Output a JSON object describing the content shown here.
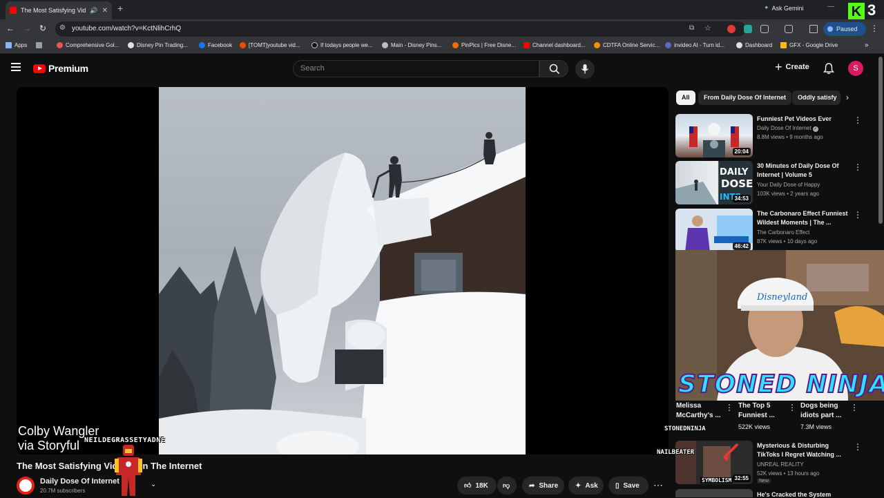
{
  "browser": {
    "tab_title": "The Most Satisfying Videos",
    "ask_gemini": "Ask Gemini",
    "url": "youtube.com/watch?v=KctNlihCrhQ",
    "paused_label": "Paused",
    "bookmarks": [
      "Apps",
      "Comprehensive Gol...",
      "Disney Pin Trading...",
      "Facebook",
      "[TOMT]youtube vid...",
      "If todays people we...",
      "Main - Disney Pins...",
      "PinPics | Free Disne...",
      "Channel dashboard...",
      "CDTFA Online Servic...",
      "invideo AI - Turn id...",
      "Dashboard",
      "GFX - Google Drive"
    ]
  },
  "overlay_badge": {
    "letter": "K",
    "number": "3"
  },
  "masthead": {
    "logo_text": "Premium",
    "search_placeholder": "Search",
    "create_label": "Create",
    "avatar_letter": "S"
  },
  "player": {
    "caption_line1": "Colby Wangler",
    "caption_line2": "via Storyful",
    "overlay_tag": "NEILDEGRASSETYADNE"
  },
  "video": {
    "title": "The Most Satisfying Videos On The Internet",
    "channel_name": "Daily Dose Of Internet",
    "subscribers": "20.7M subscribers",
    "like_count": "18K",
    "share_label": "Share",
    "ask_label": "Ask",
    "save_label": "Save"
  },
  "chips": [
    "All",
    "From Daily Dose Of Internet",
    "Oddly satisfy"
  ],
  "recommendations": [
    {
      "title": "Funniest Pet Videos Ever",
      "channel": "Daily Dose Of Internet",
      "meta": "8.8M views • 9 months ago",
      "duration": "20:04"
    },
    {
      "title": "30 Minutes of Daily Dose Of Internet | Volume 5",
      "channel": "Your Daily Dose of Happy",
      "meta": "103K views • 2 years ago",
      "duration": "34:53"
    },
    {
      "title": "The Carbonaro Effect Funniest Wildest Moments | The ...",
      "channel": "The Carbonaro Effect",
      "meta": "87K views • 10 days ago",
      "duration": "46:42"
    },
    {
      "title": "Mysterious & Disturbing TikToks I Regret Watching ...",
      "channel": "UNREAL REALITY",
      "meta": "52K views • 13 hours ago",
      "badge": "New",
      "duration": "32:55"
    },
    {
      "title": "He's Cracked the System"
    }
  ],
  "shorts": [
    {
      "title": "Melissa McCarthy's ..."
    },
    {
      "title": "The Top 5 Funniest ...",
      "views": "522K views"
    },
    {
      "title": "Dogs being idiots part ...",
      "views": "7.3M views"
    }
  ],
  "stream_overlay": {
    "banner": "STONED NINJA",
    "tag_stoned": "STONEDNINJA",
    "tag_nail": "NAILBEATER",
    "tag_symbolism": "SYMBOLISM",
    "hat_text": "Disneyland"
  }
}
